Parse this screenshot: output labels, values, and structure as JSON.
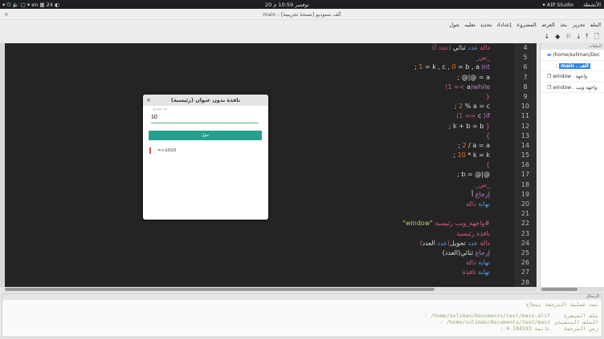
{
  "topbar": {
    "left": "▾ ⏻ 🔈 ▢   ▾ en  ▦ 24 ◐",
    "clock": "20 نوفمبر 10:59 م",
    "app": "▾ Alif Studio",
    "activities": "الأنشطة"
  },
  "window": {
    "title": "main - ألف ستوديو [نسخة تجريبية]",
    "close": "×"
  },
  "menu": [
    "الملف",
    "تحرير",
    "بحث",
    "العرض",
    "المشروع",
    "إعدادات",
    "تحديث",
    "تعليم",
    "حول"
  ],
  "toolbar": [
    "🗋",
    "⤒",
    "⤓",
    "⚐",
    "◆",
    "↓"
  ],
  "editor": {
    "line_numbers": [
      4,
      5,
      6,
      7,
      8,
      9,
      10,
      11,
      12,
      13,
      14,
      15,
      16,
      17,
      18,
      19,
      20,
      21,
      22,
      23,
      24,
      25,
      26,
      27,
      28
    ],
    "lines": [
      {
        "dir": "rtl",
        "seg": [
          {
            "t": "دالة ",
            "c": "k"
          },
          {
            "t": "عدد ",
            "c": "b"
          },
          {
            "t": "ثنائي ",
            "c": "w"
          },
          {
            "t": "(عدد أ)",
            "c": "k"
          }
        ]
      },
      {
        "dir": "rtl",
        "seg": [
          {
            "t": "_س_",
            "c": "k"
          }
        ]
      },
      {
        "dir": "ltr",
        "seg": [
          {
            "t": "; ",
            "c": "w"
          },
          {
            "t": "1",
            "c": "o"
          },
          {
            "t": " = k , c , ",
            "c": "w"
          },
          {
            "t": "0",
            "c": "o"
          },
          {
            "t": " = b , a ",
            "c": "w"
          },
          {
            "t": "int",
            "c": "p"
          }
        ]
      },
      {
        "dir": "ltr",
        "seg": [
          {
            "t": "; @|@ = a",
            "c": "w"
          }
        ]
      },
      {
        "dir": "ltr",
        "seg": [
          {
            "t": "(1 =< ",
            "c": "k"
          },
          {
            "t": "a",
            "c": "w"
          },
          {
            "t": ")while",
            "c": "p"
          }
        ]
      },
      {
        "dir": "ltr",
        "seg": [
          {
            "t": "}",
            "c": "k"
          }
        ]
      },
      {
        "dir": "ltr",
        "seg": [
          {
            "t": "; ",
            "c": "w"
          },
          {
            "t": "2",
            "c": "o"
          },
          {
            "t": " % a = c",
            "c": "w"
          }
        ]
      },
      {
        "dir": "ltr",
        "seg": [
          {
            "t": "(1 == ",
            "c": "k"
          },
          {
            "t": "c ",
            "c": "w"
          },
          {
            "t": ")if",
            "c": "p"
          }
        ]
      },
      {
        "dir": "ltr",
        "seg": [
          {
            "t": "; k + b = b ",
            "c": "w"
          },
          {
            "t": "}",
            "c": "k"
          }
        ]
      },
      {
        "dir": "ltr",
        "seg": [
          {
            "t": "{",
            "c": "k"
          }
        ]
      },
      {
        "dir": "ltr",
        "seg": [
          {
            "t": "; ",
            "c": "w"
          },
          {
            "t": "2",
            "c": "o"
          },
          {
            "t": " / a = a",
            "c": "w"
          }
        ]
      },
      {
        "dir": "ltr",
        "seg": [
          {
            "t": "; ",
            "c": "w"
          },
          {
            "t": "10",
            "c": "o"
          },
          {
            "t": " * k = k",
            "c": "w"
          }
        ]
      },
      {
        "dir": "ltr",
        "seg": [
          {
            "t": "{",
            "c": "k"
          }
        ]
      },
      {
        "dir": "ltr",
        "seg": [
          {
            "t": "; b = @|@",
            "c": "w"
          }
        ]
      },
      {
        "dir": "rtl",
        "seg": [
          {
            "t": "_س_",
            "c": "k"
          }
        ]
      },
      {
        "dir": "rtl",
        "seg": [
          {
            "t": "إرجاع ",
            "c": "p"
          },
          {
            "t": "أ",
            "c": "w"
          }
        ]
      },
      {
        "dir": "rtl",
        "seg": [
          {
            "t": "نهاية ",
            "c": "b"
          },
          {
            "t": "دالة",
            "c": "k"
          }
        ]
      },
      {
        "dir": "rtl",
        "seg": []
      },
      {
        "dir": "rtl",
        "seg": [
          {
            "t": "#واجهة_ويب رئيسية ",
            "c": "k"
          },
          {
            "t": "\"window\"",
            "c": "g"
          }
        ]
      },
      {
        "dir": "rtl",
        "seg": [
          {
            "t": "نافذة رئيسية",
            "c": "k"
          }
        ]
      },
      {
        "dir": "rtl",
        "seg": [
          {
            "t": "دالة ",
            "c": "k"
          },
          {
            "t": "عدد ",
            "c": "b"
          },
          {
            "t": "تحويل",
            "c": "w"
          },
          {
            "t": "(",
            "c": "k"
          },
          {
            "t": "عدد ",
            "c": "b"
          },
          {
            "t": "العدد",
            "c": "w"
          },
          {
            "t": ")",
            "c": "k"
          }
        ]
      },
      {
        "dir": "rtl",
        "seg": [
          {
            "t": "إرجاع ",
            "c": "p"
          },
          {
            "t": "ثنائي(العدد)",
            "c": "w"
          }
        ]
      },
      {
        "dir": "rtl",
        "seg": [
          {
            "t": "نهاية ",
            "c": "b"
          },
          {
            "t": "دالة",
            "c": "k"
          }
        ]
      },
      {
        "dir": "rtl",
        "seg": [
          {
            "t": "نهاية ",
            "c": "b"
          },
          {
            "t": "نافذة",
            "c": "k"
          }
        ]
      },
      {
        "dir": "rtl",
        "seg": []
      }
    ]
  },
  "files": {
    "header": "الملفات",
    "items": [
      "/home/suliman/Doc",
      "main . ألف",
      "window . واجهة",
      "window . واجهة ويب"
    ]
  },
  "dialog": {
    "title": "(رئيسية) نافذة بدون عنوان",
    "close": "×",
    "placeholder": "عدد عشري",
    "value": "10",
    "button": "حول",
    "output": "=>1010"
  },
  "messages": {
    "header": "الرسائل",
    "success": "تمت عملية الترجمة بنجاح",
    "rows": [
      {
        "label": "ملف الشيفرة",
        "value": ": /home/suliman/Documents/test/main.alif"
      },
      {
        "label": "الملف التنفيذي",
        "value": ": /home/suliman/Documents/test/main"
      },
      {
        "label": "زمن الترجمة",
        "value": ": 0.184333 ثانية"
      }
    ]
  }
}
